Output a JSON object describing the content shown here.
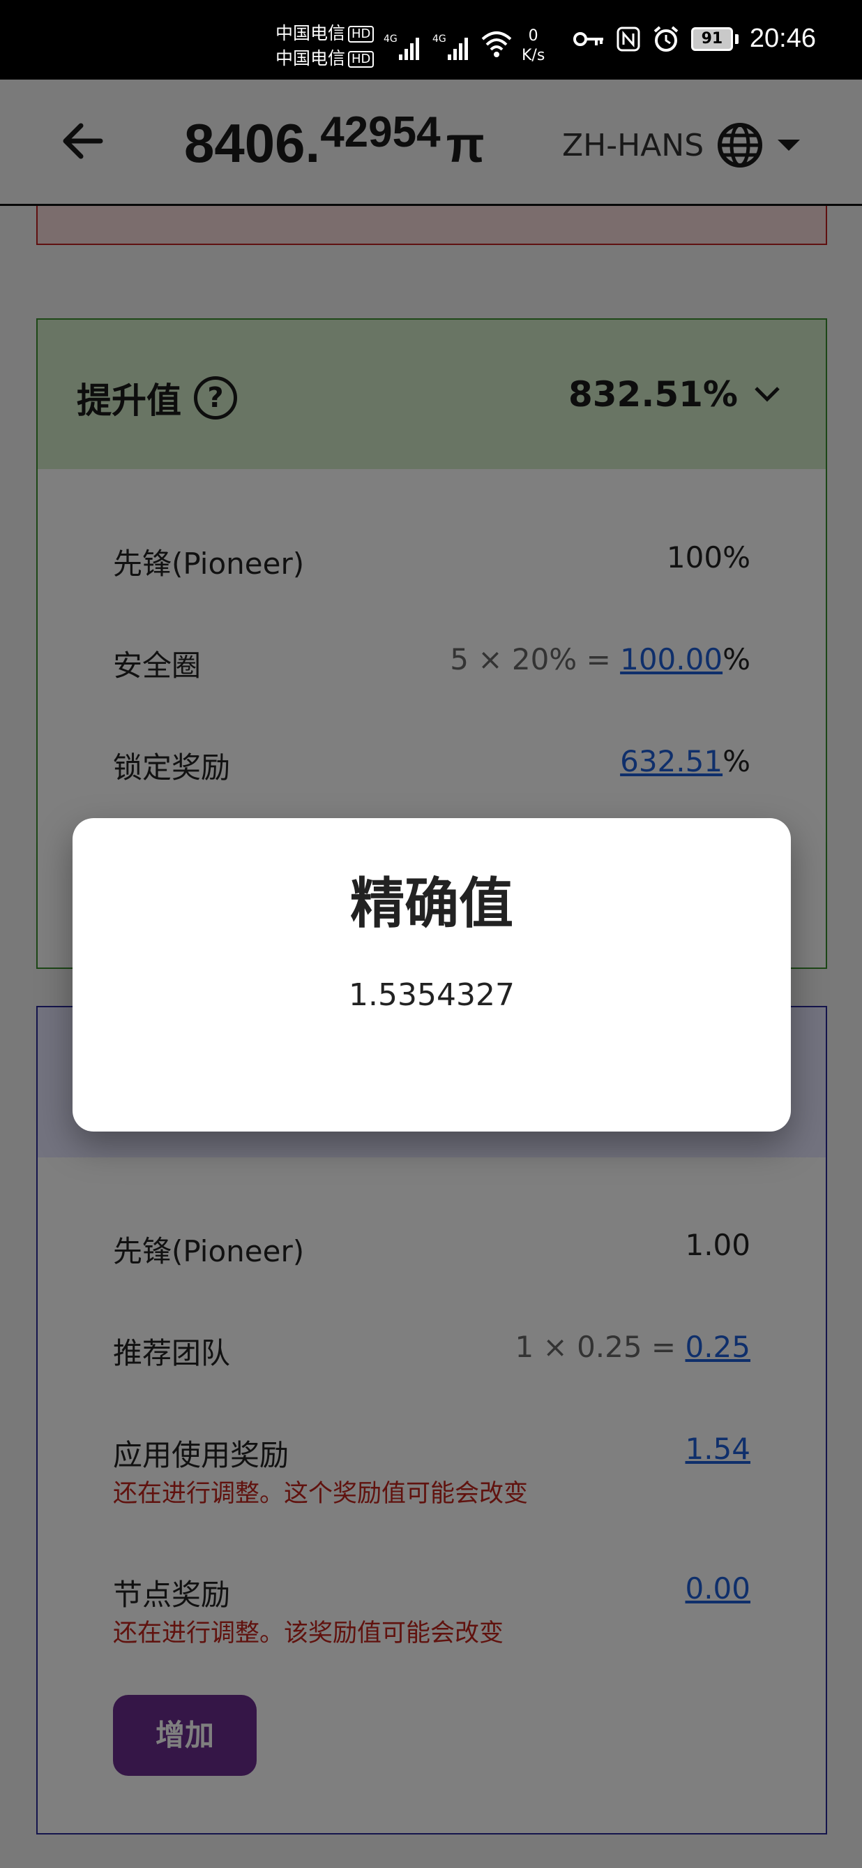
{
  "status_bar": {
    "carrier_1": "中国电信",
    "carrier_2": "中国电信",
    "hd_badge": "HD",
    "network_type": "4G",
    "net_speed_value": "0",
    "net_speed_unit": "K/s",
    "battery": "91",
    "time": "20:46"
  },
  "header": {
    "balance_integer": "8406.",
    "balance_decimal": "42954",
    "currency_symbol": "π",
    "language": "ZH-HANS"
  },
  "boost_card": {
    "title": "提升值",
    "total": "832.51%",
    "accent_color": "#3a8f2e",
    "rows": [
      {
        "label": "先锋(Pioneer)",
        "value": "100%"
      },
      {
        "label": "安全圈",
        "calc": "5 × 20% = ",
        "link": "100.00",
        "suffix": "%"
      },
      {
        "label": "锁定奖励",
        "link": "632.51",
        "suffix": "%"
      }
    ]
  },
  "base_card": {
    "accent_color": "#2a2a9a",
    "rows": [
      {
        "label": "先锋(Pioneer)",
        "value": "1.00"
      },
      {
        "label": "推荐团队",
        "calc": "1 × 0.25 = ",
        "link": "0.25"
      },
      {
        "label": "应用使用奖励",
        "link": "1.54",
        "note": "还在进行调整。这个奖励值可能会改变"
      },
      {
        "label": "节点奖励",
        "link": "0.00",
        "note": "还在进行调整。该奖励值可能会改变"
      }
    ],
    "add_button": "增加"
  },
  "dialog": {
    "title": "精确值",
    "value": "1.5354327"
  }
}
